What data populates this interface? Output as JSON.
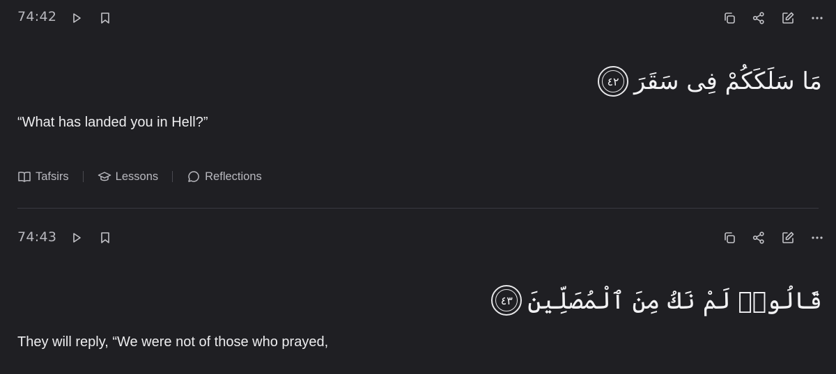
{
  "verses": [
    {
      "key": "74:42",
      "arabic": "مَا سَلَكَكُمْ فِى سَقَرَ",
      "ayah_number": "٤٢",
      "translation": "“What has landed you in Hell?”",
      "tabs": [
        {
          "label": "Tafsirs",
          "icon": "book-icon"
        },
        {
          "label": "Lessons",
          "icon": "graduation-cap-icon"
        },
        {
          "label": "Reflections",
          "icon": "chat-bubble-icon"
        }
      ]
    },
    {
      "key": "74:43",
      "arabic": "قَالُوا۟ لَمْ نَكُ مِنَ ٱلْمُصَلِّينَ",
      "ayah_number": "٤٣",
      "translation": "They will reply, “We were not of those who prayed,"
    }
  ],
  "actions": [
    "play-icon",
    "bookmark-icon",
    "copy-icon",
    "share-icon",
    "edit-icon",
    "more-icon"
  ]
}
